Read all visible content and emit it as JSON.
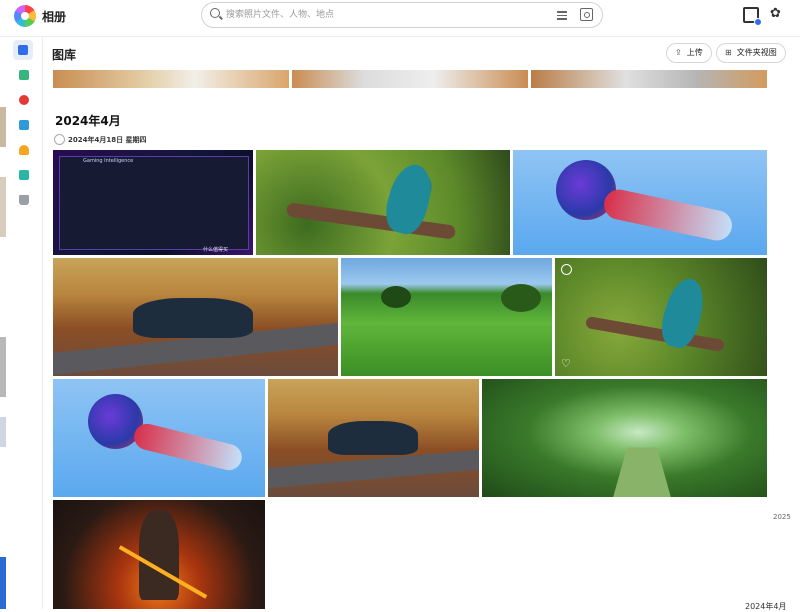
{
  "app": {
    "title": "相册"
  },
  "search": {
    "placeholder": "搜索照片文件、人物、地点"
  },
  "toolbar": {
    "icons": [
      "filter-icon",
      "vision-search-icon",
      "calendar-badge-icon",
      "gear-icon"
    ],
    "settings_glyph": "✿"
  },
  "sidebar": {
    "items": [
      {
        "name": "sidebar-item-gallery",
        "icon": "picture-icon",
        "color": "#2f6ee8",
        "active": true
      },
      {
        "name": "sidebar-item-albums",
        "icon": "albums-icon",
        "color": "#37b47e"
      },
      {
        "name": "sidebar-item-favorites",
        "icon": "heart-icon",
        "color": "#e53935"
      },
      {
        "name": "sidebar-item-screen",
        "icon": "monitor-icon",
        "color": "#2f9ad8"
      },
      {
        "name": "sidebar-item-people",
        "icon": "people-icon",
        "color": "#f5a623"
      },
      {
        "name": "sidebar-item-shared",
        "icon": "shared-icon",
        "color": "#2bb5a6"
      },
      {
        "name": "sidebar-item-trash",
        "icon": "trash-icon",
        "color": "#9aa0a6"
      }
    ]
  },
  "header": {
    "title": "图库",
    "upload_label": "上传",
    "upload_glyph": "⇪",
    "folder_view_label": "文件夹视图",
    "folder_view_glyph": "⊞"
  },
  "timeline": {
    "month_label": "2024年4月",
    "date_label": "2024年4月18日 星期四",
    "year_badge": "2025",
    "next_month_label": "2024年4月"
  },
  "photos": [
    {
      "name": "photo-gaming-software",
      "subject": "gaming software screenshot",
      "overlay_text": "Gaming Intelligence",
      "watermark": "什么值得买"
    },
    {
      "name": "photo-blue-bird",
      "subject": "blue bird on branch"
    },
    {
      "name": "photo-jellyfish",
      "subject": "jellyfish"
    },
    {
      "name": "photo-classic-car",
      "subject": "vintage car autumn road"
    },
    {
      "name": "photo-green-hills",
      "subject": "green hills"
    },
    {
      "name": "photo-blue-bird-2",
      "subject": "blue bird on branch"
    },
    {
      "name": "photo-jellyfish-2",
      "subject": "jellyfish"
    },
    {
      "name": "photo-classic-car-2",
      "subject": "vintage car autumn road"
    },
    {
      "name": "photo-mossy-forest",
      "subject": "mossy forest path"
    },
    {
      "name": "photo-tiger-warrior",
      "subject": "tiger warrior fire"
    }
  ]
}
